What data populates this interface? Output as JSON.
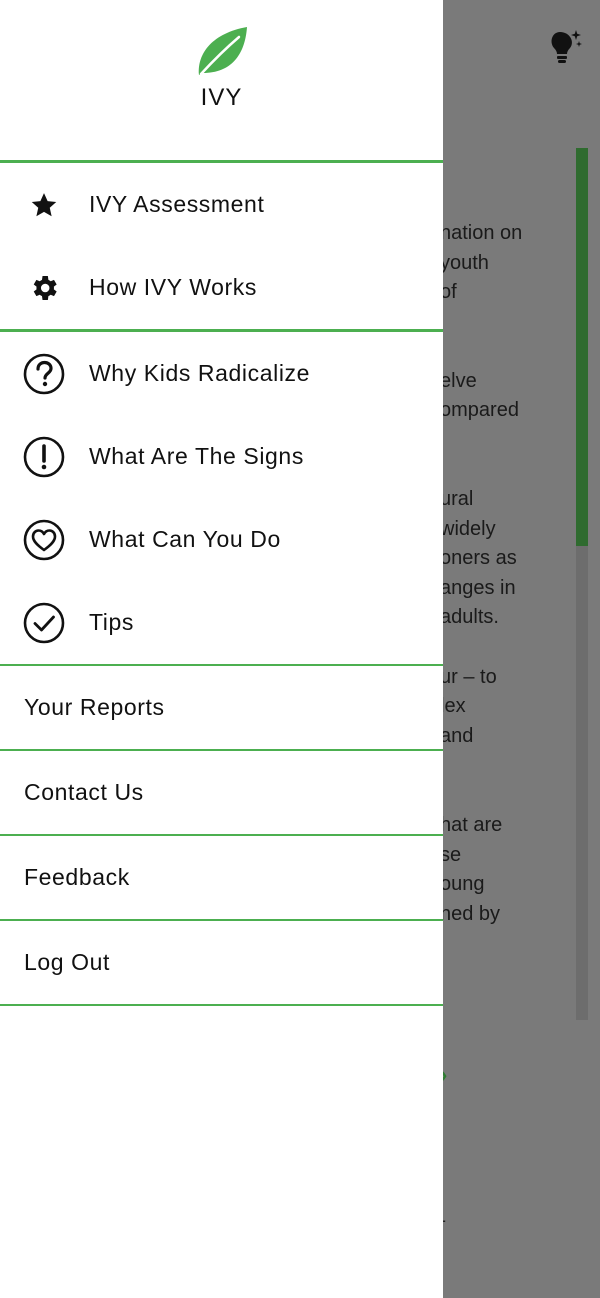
{
  "drawer": {
    "brand": "IVY",
    "primary_items": [
      {
        "label": "IVY Assessment",
        "icon": "star-icon"
      },
      {
        "label": "How IVY Works",
        "icon": "gear-icon"
      }
    ],
    "info_items": [
      {
        "label": "Why Kids Radicalize",
        "icon": "question-circle-icon"
      },
      {
        "label": "What Are The Signs",
        "icon": "exclamation-circle-icon"
      },
      {
        "label": "What Can You Do",
        "icon": "heart-circle-icon"
      },
      {
        "label": "Tips",
        "icon": "check-circle-icon"
      }
    ],
    "account_items": [
      {
        "label": "Your Reports"
      },
      {
        "label": "Contact Us"
      },
      {
        "label": "Feedback"
      },
      {
        "label": "Log Out"
      }
    ]
  },
  "background": {
    "lines": [
      "nation on",
      "youth",
      "of",
      "elve",
      "ompared",
      "ural",
      "widely",
      "oners as",
      "anges in",
      "adults.",
      "ur – to",
      "lex",
      "and",
      "hat are",
      "se",
      "oung",
      "ned by"
    ],
    "chevron": "›",
    "dash": "-"
  },
  "colors": {
    "accent": "#4caf50",
    "leaf": "#4caf50",
    "overlay": "#7a7a7a"
  }
}
